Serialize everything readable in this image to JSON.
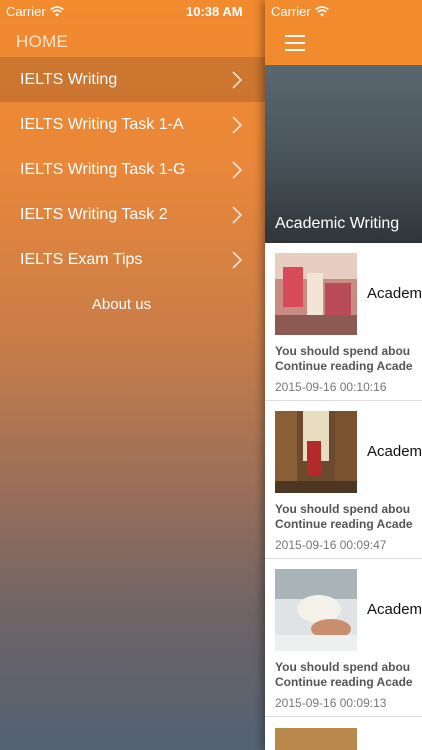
{
  "status": {
    "carrier": "Carrier",
    "time": "10:38 AM"
  },
  "menu": {
    "home": "HOME",
    "items": [
      {
        "label": "IELTS Writing"
      },
      {
        "label": "IELTS Writing Task 1-A"
      },
      {
        "label": "IELTS Writing Task 1-G"
      },
      {
        "label": "IELTS Writing Task 2"
      },
      {
        "label": "IELTS Exam Tips"
      }
    ],
    "about": "About us"
  },
  "main": {
    "carrier": "Carrier",
    "hero_title": "Academic Writing",
    "posts": [
      {
        "title": "Academ",
        "excerpt1": "You should spend abou",
        "excerpt2": "Continue reading Acade",
        "date": "2015-09-16 00:10:16"
      },
      {
        "title": "Academ",
        "excerpt1": "You should spend abou",
        "excerpt2": "Continue reading Acade",
        "date": "2015-09-16 00:09:47"
      },
      {
        "title": "Academ",
        "excerpt1": "You should spend abou",
        "excerpt2": "Continue reading Acade",
        "date": "2015-09-16 00:09:13"
      }
    ]
  },
  "colors": {
    "accent": "#f28a2e",
    "menu_bottom": "#526273"
  },
  "icons": [
    "wifi-icon",
    "chevron-right-icon",
    "hamburger-icon"
  ]
}
